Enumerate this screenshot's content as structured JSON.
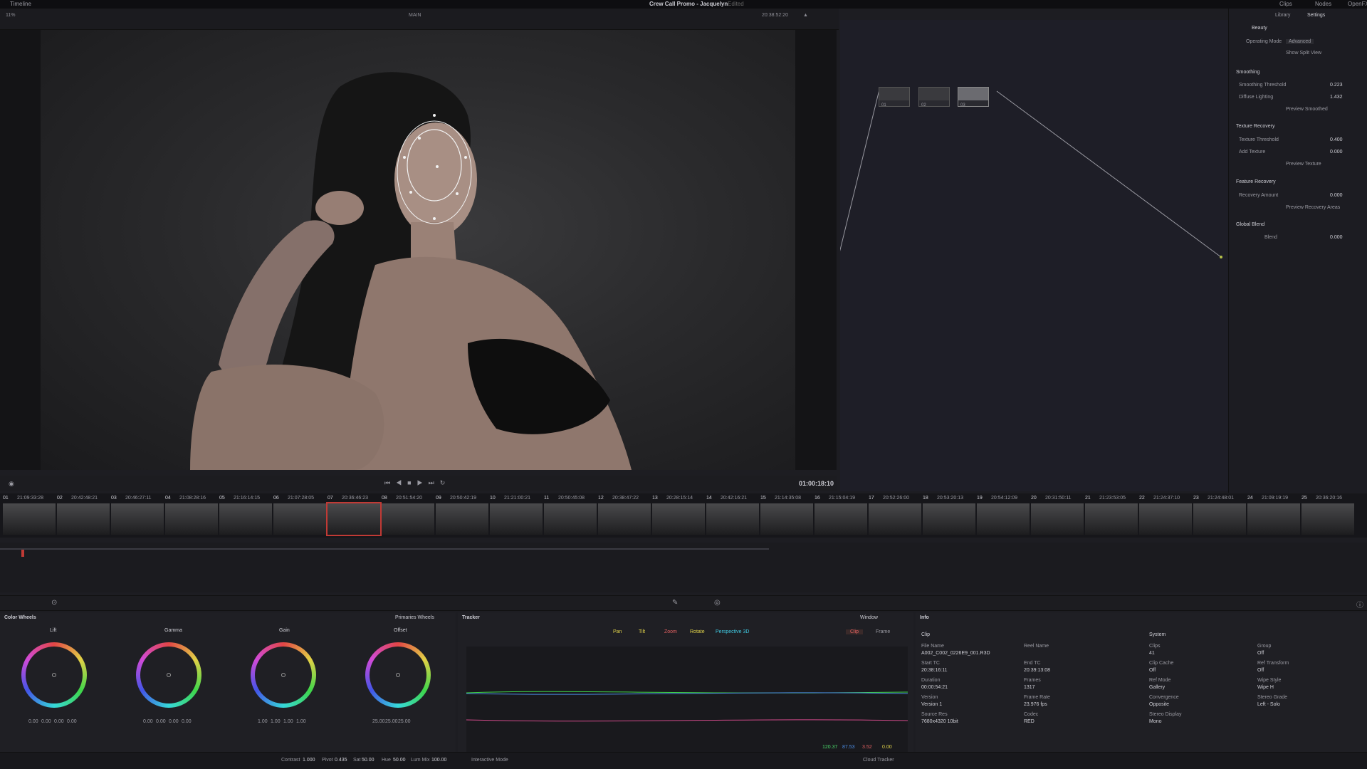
{
  "app": {
    "timeline_label": "Timeline",
    "project_title": "Crew Call Promo - Jacquelyn",
    "edited_label": "Edited",
    "clips_label": "Clips",
    "nodes_label": "Nodes",
    "openfx_label": "OpenFX"
  },
  "viewer_toolbar": {
    "zoom": "11%",
    "timeline_name": "MAIN",
    "timecode": "20:38:52:20",
    "clip_label": "Clip"
  },
  "transport": {
    "current_timecode": "01:00:18:10"
  },
  "settings_panel": {
    "tab_library": "Library",
    "tab_settings": "Settings",
    "plugin_name": "Beauty",
    "operating_mode_label": "Operating Mode",
    "operating_mode_value": "Advanced",
    "show_split_view": "Show Split View",
    "section_smoothing": "Smoothing",
    "smoothing_threshold_label": "Smoothing Threshold",
    "smoothing_threshold_value": "0.223",
    "diffuse_lighting_label": "Diffuse Lighting",
    "diffuse_lighting_value": "1.432",
    "preview_smoothed": "Preview Smoothed",
    "section_texture": "Texture Recovery",
    "texture_threshold_label": "Texture Threshold",
    "texture_threshold_value": "0.400",
    "add_texture_label": "Add Texture",
    "add_texture_value": "0.000",
    "preview_texture": "Preview Texture",
    "section_recovery": "Feature Recovery",
    "recovery_amount_label": "Recovery Amount",
    "recovery_amount_value": "0.000",
    "preview_recovery": "Preview Recovery Areas",
    "section_global": "Global Blend",
    "blend_label": "Blend",
    "blend_value": "0.000"
  },
  "nodes": [
    {
      "label": "01"
    },
    {
      "label": "02"
    },
    {
      "label": "03"
    }
  ],
  "clips": [
    {
      "num": "01",
      "tc": "21:09:33:28"
    },
    {
      "num": "02",
      "tc": "20:42:48:21"
    },
    {
      "num": "03",
      "tc": "20:46:27:11"
    },
    {
      "num": "04",
      "tc": "21:08:28:16"
    },
    {
      "num": "05",
      "tc": "21:16:14:15"
    },
    {
      "num": "06",
      "tc": "21:07:28:05"
    },
    {
      "num": "07",
      "tc": "20:36:46:23"
    },
    {
      "num": "08",
      "tc": "20:51:54:20"
    },
    {
      "num": "09",
      "tc": "20:50:42:19"
    },
    {
      "num": "10",
      "tc": "21:21:00:21"
    },
    {
      "num": "11",
      "tc": "20:50:45:08"
    },
    {
      "num": "12",
      "tc": "20:38:47:22"
    },
    {
      "num": "13",
      "tc": "20:28:15:14"
    },
    {
      "num": "14",
      "tc": "20:42:16:21"
    },
    {
      "num": "15",
      "tc": "21:14:35:08"
    },
    {
      "num": "16",
      "tc": "21:15:04:19"
    },
    {
      "num": "17",
      "tc": "20:52:26:00"
    },
    {
      "num": "18",
      "tc": "20:53:20:13"
    },
    {
      "num": "19",
      "tc": "20:54:12:09"
    },
    {
      "num": "20",
      "tc": "20:31:50:11"
    },
    {
      "num": "21",
      "tc": "21:23:53:05"
    },
    {
      "num": "22",
      "tc": "21:24:37:10"
    },
    {
      "num": "23",
      "tc": "21:24:48:01"
    },
    {
      "num": "24",
      "tc": "21:09:19:19"
    },
    {
      "num": "25",
      "tc": "20:36:20:16"
    }
  ],
  "color_wheels": {
    "title": "Color Wheels",
    "mode": "Primaries Wheels",
    "wheels": [
      {
        "name": "Lift",
        "values": [
          "0.00",
          "0.00",
          "0.00",
          "0.00"
        ],
        "color": "#e04a4a"
      },
      {
        "name": "Gamma",
        "values": [
          "0.00",
          "0.00",
          "0.00",
          "0.00"
        ],
        "color": "#e0c84a"
      },
      {
        "name": "Gain",
        "values": [
          "1.00",
          "1.00",
          "1.00",
          "1.00"
        ],
        "color": "#4ad86a"
      },
      {
        "name": "Offset",
        "values": [
          "25.00",
          "25.00",
          "25.00"
        ],
        "color": "#4a6ae0"
      }
    ]
  },
  "tracker": {
    "title": "Tracker",
    "options": [
      "Pan",
      "Tilt",
      "Zoom",
      "Rotate",
      "Perspective 3D"
    ],
    "clip_btn": "Clip",
    "frame_btn": "Frame",
    "readouts": [
      "120.37",
      "87.53",
      "3.52",
      "0.00"
    ]
  },
  "window_label": "Window",
  "info": {
    "title": "Info",
    "clip_heading": "Clip",
    "system_heading": "System",
    "rows": [
      {
        "label": "File Name",
        "value": "A002_C002_0226E9_001.R3D"
      },
      {
        "label": "Start TC",
        "value": "20:38:16:11"
      },
      {
        "label": "Duration",
        "value": "00:00:54:21"
      },
      {
        "label": "Version",
        "value": "Version 1"
      },
      {
        "label": "Source Res",
        "value": "7680x4320 10bit"
      }
    ],
    "rows2": [
      {
        "label": "Reel Name",
        "value": ""
      },
      {
        "label": "End TC",
        "value": "20:39:13:08"
      },
      {
        "label": "Frames",
        "value": "1317"
      },
      {
        "label": "Frame Rate",
        "value": "23.976 fps"
      },
      {
        "label": "Codec",
        "value": "RED"
      }
    ],
    "rows3": [
      {
        "label": "Clips",
        "value": "41"
      },
      {
        "label": "Clip Cache",
        "value": "Off"
      },
      {
        "label": "Ref Mode",
        "value": "Gallery"
      },
      {
        "label": "Convergence",
        "value": "Opposite"
      },
      {
        "label": "Stereo Display",
        "value": "Mono"
      }
    ],
    "rows4": [
      {
        "label": "Group",
        "value": "Off"
      },
      {
        "label": "Ref Transform",
        "value": "Off"
      },
      {
        "label": "Wipe Style",
        "value": "Wipe H"
      },
      {
        "label": "Stereo Grade",
        "value": "Left - Solo"
      }
    ]
  },
  "statusbar": {
    "contrast_label": "Contrast",
    "contrast_value": "1.000",
    "pivot_label": "Pivot",
    "pivot_value": "0.435",
    "sat_label": "Sat",
    "sat_value": "50.00",
    "hue_label": "Hue",
    "hue_value": "50.00",
    "lum_mix_label": "Lum Mix",
    "lum_mix_value": "100.00",
    "interactive_mode": "Interactive Mode",
    "cloud_tracker": "Cloud Tracker"
  }
}
